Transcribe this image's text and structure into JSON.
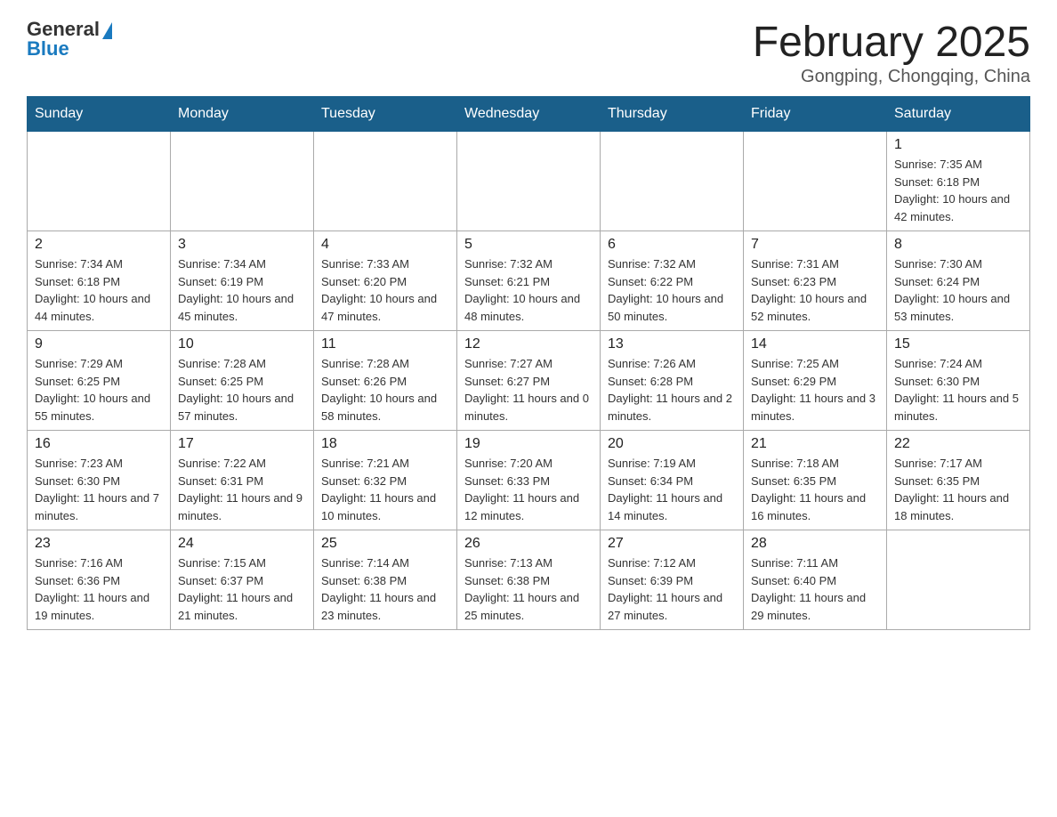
{
  "header": {
    "logo": {
      "general": "General",
      "blue": "Blue",
      "triangle_color": "#1a7abf"
    },
    "title": "February 2025",
    "subtitle": "Gongping, Chongqing, China"
  },
  "weekdays": [
    "Sunday",
    "Monday",
    "Tuesday",
    "Wednesday",
    "Thursday",
    "Friday",
    "Saturday"
  ],
  "weeks": [
    [
      {
        "day": "",
        "sunrise": "",
        "sunset": "",
        "daylight": ""
      },
      {
        "day": "",
        "sunrise": "",
        "sunset": "",
        "daylight": ""
      },
      {
        "day": "",
        "sunrise": "",
        "sunset": "",
        "daylight": ""
      },
      {
        "day": "",
        "sunrise": "",
        "sunset": "",
        "daylight": ""
      },
      {
        "day": "",
        "sunrise": "",
        "sunset": "",
        "daylight": ""
      },
      {
        "day": "",
        "sunrise": "",
        "sunset": "",
        "daylight": ""
      },
      {
        "day": "1",
        "sunrise": "Sunrise: 7:35 AM",
        "sunset": "Sunset: 6:18 PM",
        "daylight": "Daylight: 10 hours and 42 minutes."
      }
    ],
    [
      {
        "day": "2",
        "sunrise": "Sunrise: 7:34 AM",
        "sunset": "Sunset: 6:18 PM",
        "daylight": "Daylight: 10 hours and 44 minutes."
      },
      {
        "day": "3",
        "sunrise": "Sunrise: 7:34 AM",
        "sunset": "Sunset: 6:19 PM",
        "daylight": "Daylight: 10 hours and 45 minutes."
      },
      {
        "day": "4",
        "sunrise": "Sunrise: 7:33 AM",
        "sunset": "Sunset: 6:20 PM",
        "daylight": "Daylight: 10 hours and 47 minutes."
      },
      {
        "day": "5",
        "sunrise": "Sunrise: 7:32 AM",
        "sunset": "Sunset: 6:21 PM",
        "daylight": "Daylight: 10 hours and 48 minutes."
      },
      {
        "day": "6",
        "sunrise": "Sunrise: 7:32 AM",
        "sunset": "Sunset: 6:22 PM",
        "daylight": "Daylight: 10 hours and 50 minutes."
      },
      {
        "day": "7",
        "sunrise": "Sunrise: 7:31 AM",
        "sunset": "Sunset: 6:23 PM",
        "daylight": "Daylight: 10 hours and 52 minutes."
      },
      {
        "day": "8",
        "sunrise": "Sunrise: 7:30 AM",
        "sunset": "Sunset: 6:24 PM",
        "daylight": "Daylight: 10 hours and 53 minutes."
      }
    ],
    [
      {
        "day": "9",
        "sunrise": "Sunrise: 7:29 AM",
        "sunset": "Sunset: 6:25 PM",
        "daylight": "Daylight: 10 hours and 55 minutes."
      },
      {
        "day": "10",
        "sunrise": "Sunrise: 7:28 AM",
        "sunset": "Sunset: 6:25 PM",
        "daylight": "Daylight: 10 hours and 57 minutes."
      },
      {
        "day": "11",
        "sunrise": "Sunrise: 7:28 AM",
        "sunset": "Sunset: 6:26 PM",
        "daylight": "Daylight: 10 hours and 58 minutes."
      },
      {
        "day": "12",
        "sunrise": "Sunrise: 7:27 AM",
        "sunset": "Sunset: 6:27 PM",
        "daylight": "Daylight: 11 hours and 0 minutes."
      },
      {
        "day": "13",
        "sunrise": "Sunrise: 7:26 AM",
        "sunset": "Sunset: 6:28 PM",
        "daylight": "Daylight: 11 hours and 2 minutes."
      },
      {
        "day": "14",
        "sunrise": "Sunrise: 7:25 AM",
        "sunset": "Sunset: 6:29 PM",
        "daylight": "Daylight: 11 hours and 3 minutes."
      },
      {
        "day": "15",
        "sunrise": "Sunrise: 7:24 AM",
        "sunset": "Sunset: 6:30 PM",
        "daylight": "Daylight: 11 hours and 5 minutes."
      }
    ],
    [
      {
        "day": "16",
        "sunrise": "Sunrise: 7:23 AM",
        "sunset": "Sunset: 6:30 PM",
        "daylight": "Daylight: 11 hours and 7 minutes."
      },
      {
        "day": "17",
        "sunrise": "Sunrise: 7:22 AM",
        "sunset": "Sunset: 6:31 PM",
        "daylight": "Daylight: 11 hours and 9 minutes."
      },
      {
        "day": "18",
        "sunrise": "Sunrise: 7:21 AM",
        "sunset": "Sunset: 6:32 PM",
        "daylight": "Daylight: 11 hours and 10 minutes."
      },
      {
        "day": "19",
        "sunrise": "Sunrise: 7:20 AM",
        "sunset": "Sunset: 6:33 PM",
        "daylight": "Daylight: 11 hours and 12 minutes."
      },
      {
        "day": "20",
        "sunrise": "Sunrise: 7:19 AM",
        "sunset": "Sunset: 6:34 PM",
        "daylight": "Daylight: 11 hours and 14 minutes."
      },
      {
        "day": "21",
        "sunrise": "Sunrise: 7:18 AM",
        "sunset": "Sunset: 6:35 PM",
        "daylight": "Daylight: 11 hours and 16 minutes."
      },
      {
        "day": "22",
        "sunrise": "Sunrise: 7:17 AM",
        "sunset": "Sunset: 6:35 PM",
        "daylight": "Daylight: 11 hours and 18 minutes."
      }
    ],
    [
      {
        "day": "23",
        "sunrise": "Sunrise: 7:16 AM",
        "sunset": "Sunset: 6:36 PM",
        "daylight": "Daylight: 11 hours and 19 minutes."
      },
      {
        "day": "24",
        "sunrise": "Sunrise: 7:15 AM",
        "sunset": "Sunset: 6:37 PM",
        "daylight": "Daylight: 11 hours and 21 minutes."
      },
      {
        "day": "25",
        "sunrise": "Sunrise: 7:14 AM",
        "sunset": "Sunset: 6:38 PM",
        "daylight": "Daylight: 11 hours and 23 minutes."
      },
      {
        "day": "26",
        "sunrise": "Sunrise: 7:13 AM",
        "sunset": "Sunset: 6:38 PM",
        "daylight": "Daylight: 11 hours and 25 minutes."
      },
      {
        "day": "27",
        "sunrise": "Sunrise: 7:12 AM",
        "sunset": "Sunset: 6:39 PM",
        "daylight": "Daylight: 11 hours and 27 minutes."
      },
      {
        "day": "28",
        "sunrise": "Sunrise: 7:11 AM",
        "sunset": "Sunset: 6:40 PM",
        "daylight": "Daylight: 11 hours and 29 minutes."
      },
      {
        "day": "",
        "sunrise": "",
        "sunset": "",
        "daylight": ""
      }
    ]
  ]
}
